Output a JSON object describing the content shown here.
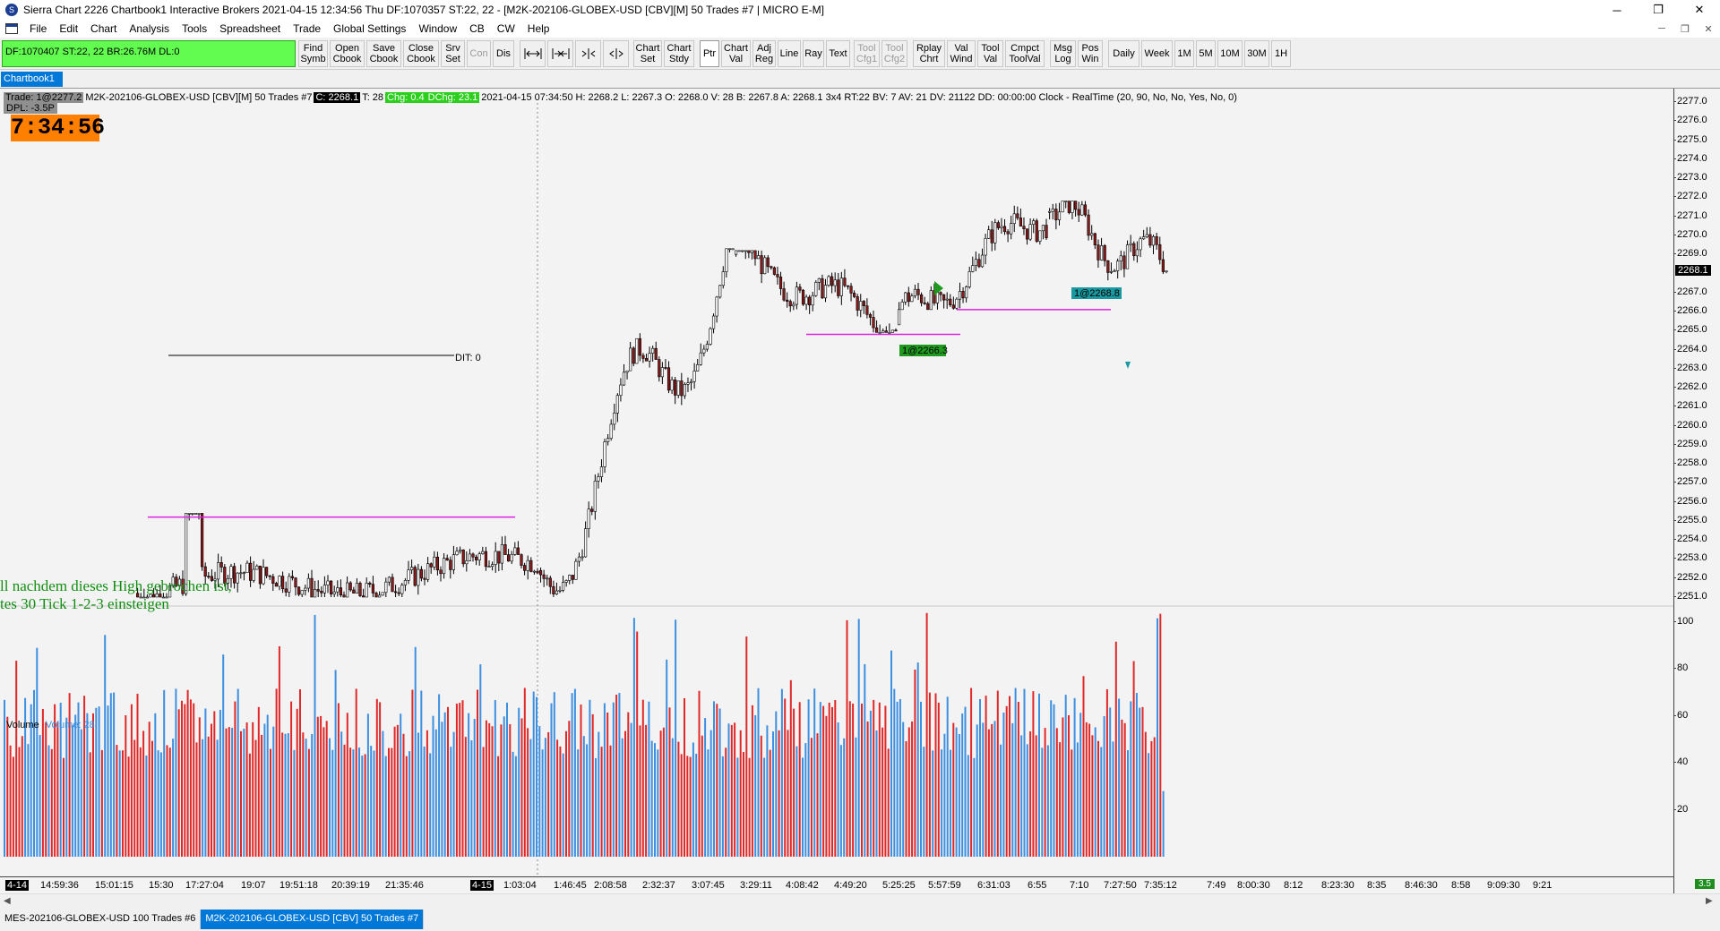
{
  "window": {
    "title": "Sierra Chart 2226 Chartbook1  Interactive Brokers 2021-04-15  12:34:56 Thu  DF:1070357  ST:22, 22 - [M2K-202106-GLOBEX-USD [CBV][M]  50 Trades  #7 | MICRO E-M]",
    "minimize": "─",
    "maximize": "❐",
    "close": "✕",
    "mdi_minimize": "─",
    "mdi_restore": "❐",
    "mdi_close": "✕"
  },
  "menu": [
    "File",
    "Edit",
    "Chart",
    "Analysis",
    "Tools",
    "Spreadsheet",
    "Trade",
    "Global Settings",
    "Window",
    "CB",
    "CW",
    "Help"
  ],
  "status_box": "DF:1070407  ST:22, 22  BR:26.76M  DL:0",
  "toolbar": {
    "find_symb": "Find\nSymb",
    "open_cbook": "Open\nCbook",
    "save_cbook": "Save\nCbook",
    "close_cbook": "Close\nCbook",
    "srv_set": "Srv\nSet",
    "con": "Con",
    "dis": "Dis",
    "chart_set": "Chart\nSet",
    "chart_stdy": "Chart\nStdy",
    "ptr": "Ptr",
    "chart_val": "Chart\nVal",
    "adj_reg": "Adj\nReg",
    "line": "Line",
    "ray": "Ray",
    "text": "Text",
    "tool_cfg1": "Tool\nCfg1",
    "tool_cfg2": "Tool\nCfg2",
    "rplay_chrt": "Rplay\nChrt",
    "val_wind": "Val\nWind",
    "tool_val": "Tool\nVal",
    "cmpct_toolval": "Cmpct\nToolVal",
    "msg_log": "Msg\nLog",
    "pos_win": "Pos\nWin",
    "daily": "Daily",
    "week": "Week",
    "tf_1m": "1M",
    "tf_5m": "5M",
    "tf_10m": "10M",
    "tf_30m": "30M",
    "tf_1h": "1H"
  },
  "chart_tab": "Chartbook1",
  "header": {
    "trade": "Trade: 1@2277.2",
    "symbol": "M2K-202106-GLOBEX-USD [CBV][M]  50 Trades  #7",
    "c": "C: 2268.1",
    "t": "T: 28",
    "chg": "Chg: 0.4",
    "dchg": "DChg: 23.1",
    "rest": "2021-04-15 07:34:50 H: 2268.2 L: 2267.3 O: 2268.0 V: 28 B: 2267.8 A: 2268.1 3x4 RT:22 BV: 7 AV: 21 DV: 21122 DD: 00:00:00 Clock - RealTime  (20, 90, No, No, Yes, No, 0)",
    "dpl": "DPL: -3.5P"
  },
  "clock": "7:34:56",
  "annotation": {
    "line1": "ll nachdem dieses High gebrochen ist,",
    "line2": "tes 30 Tick 1-2-3 einsteigen"
  },
  "dit_label": "DIT: 0",
  "order_labels": {
    "buy": "1@2266.3",
    "sell": "1@2268.8"
  },
  "volume_label": {
    "name": "Volume",
    "value": "Volume: 28"
  },
  "price_axis": {
    "labels": [
      "2277.0",
      "2276.0",
      "2275.0",
      "2274.0",
      "2273.0",
      "2272.0",
      "2271.0",
      "2270.0",
      "2269.0",
      "2268.1",
      "2267.0",
      "2266.0",
      "2265.0",
      "2264.0",
      "2263.0",
      "2262.0",
      "2261.0",
      "2260.0",
      "2259.0",
      "2258.0",
      "2257.0",
      "2256.0",
      "2255.0",
      "2254.0",
      "2253.0",
      "2252.0",
      "2251.0"
    ],
    "current": "2268.1"
  },
  "volume_axis": [
    "100",
    "80",
    "60",
    "40",
    "20"
  ],
  "time_axis": [
    "4-14",
    "14:59:36",
    "15:01:15",
    "15:30",
    "17:27:04",
    "19:07",
    "19:51:18",
    "20:39:19",
    "21:35:46",
    "4-15",
    "1:03:04",
    "1:46:45",
    "2:08:58",
    "2:32:37",
    "3:07:45",
    "3:29:11",
    "4:08:42",
    "4:49:20",
    "5:25:25",
    "5:57:59",
    "6:31:03",
    "6:55",
    "7:10",
    "7:27:50",
    "7:35:12",
    "7:49",
    "8:00:30",
    "8:12",
    "8:23:30",
    "8:35",
    "8:46:30",
    "8:58",
    "9:09:30",
    "9:21"
  ],
  "corner_badge": "3.5",
  "bottom_tabs": [
    "MES-202106-GLOBEX-USD  100 Trades  #6",
    "M2K-202106-GLOBEX-USD [CBV]  50 Trades  #7"
  ],
  "colors": {
    "up_candle": "#ffffff",
    "candle_outline": "#000000",
    "down_candle": "#8b1a1a",
    "volume_up": "#3d8fe0",
    "volume_down": "#e02828",
    "level_line": "#e020e0",
    "annotation": "#128f12",
    "status_green": "#62fb4f",
    "clock_bg": "#ff7f00"
  },
  "chart_data": {
    "type": "candlestick",
    "y_unit": "price",
    "ylim": [
      2250.6,
      2277.3
    ],
    "volume_ylim": [
      0,
      110
    ],
    "grid": false,
    "levels": [
      2255.2,
      2264.8,
      2266.1
    ],
    "session_break_at_label": "4-15",
    "series": [
      {
        "name": "Volume",
        "segments": [
          {
            "start_label": "4-14",
            "end_label": "4-15",
            "from": 2251.2,
            "to": 2252.6,
            "high": 2255.4,
            "low": 2251.0,
            "note_high_at": "17:27:04"
          },
          {
            "start_label": "4-15",
            "end_label": "3:07:45",
            "from": 2252.4,
            "to": 2269.1,
            "high": 2269.3,
            "low": 2251.0
          },
          {
            "start_label": "3:07:45",
            "end_label": "5:25:25",
            "from": 2269.0,
            "to": 2265.2,
            "high": 2269.2,
            "low": 2264.9
          },
          {
            "start_label": "5:25:25",
            "end_label": "6:55",
            "from": 2265.3,
            "to": 2271.4,
            "high": 2271.6,
            "low": 2266.1
          },
          {
            "start_label": "6:55",
            "end_label": "7:35:12",
            "from": 2271.2,
            "to": 2268.1,
            "high": 2271.8,
            "low": 2265.6
          }
        ]
      }
    ]
  }
}
